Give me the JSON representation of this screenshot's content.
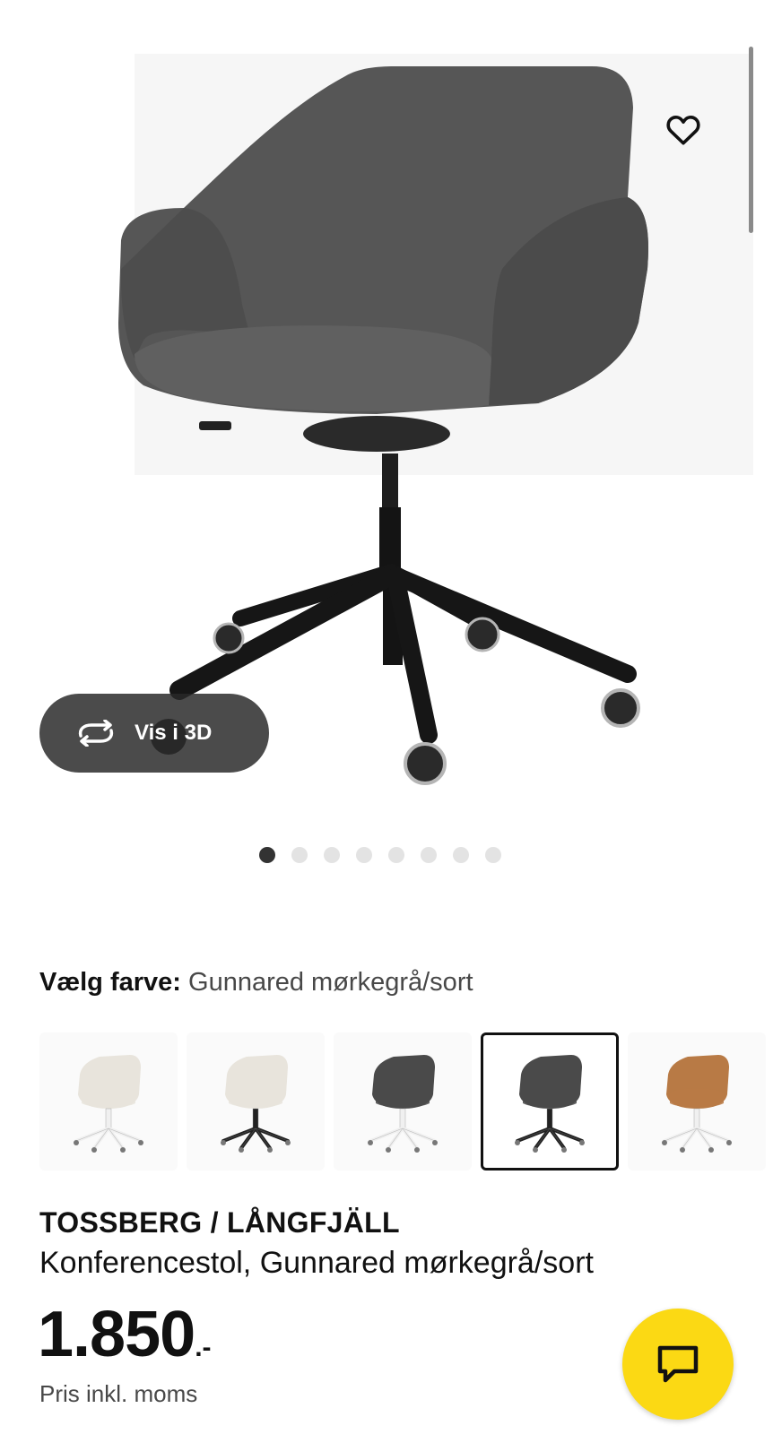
{
  "hero": {
    "view3d_label": "Vis i 3D",
    "active_slide": 1,
    "slide_count": 8
  },
  "color": {
    "label": "Vælg farve:",
    "value": "Gunnared mørkegrå/sort"
  },
  "swatches": [
    {
      "seat": "#e8e4dc",
      "base": "#f0f0f0",
      "selected": false
    },
    {
      "seat": "#e8e4dc",
      "base": "#222222",
      "selected": false
    },
    {
      "seat": "#4a4a4a",
      "base": "#f0f0f0",
      "selected": false
    },
    {
      "seat": "#4a4a4a",
      "base": "#222222",
      "selected": true
    },
    {
      "seat": "#b87a45",
      "base": "#f0f0f0",
      "selected": false
    }
  ],
  "product": {
    "name": "TOSSBERG / LÅNGFJÄLL",
    "description": "Konferencestol, Gunnared mørkegrå/sort"
  },
  "price": {
    "amount": "1.850",
    "suffix": ".-",
    "note": "Pris inkl. moms"
  },
  "icons": {
    "favorite": "heart-icon",
    "view3d": "rotate-3d-icon",
    "chat": "chat-bubble-icon"
  },
  "colors": {
    "chat_button": "#fbd914",
    "text": "#111111",
    "muted": "#484848"
  }
}
